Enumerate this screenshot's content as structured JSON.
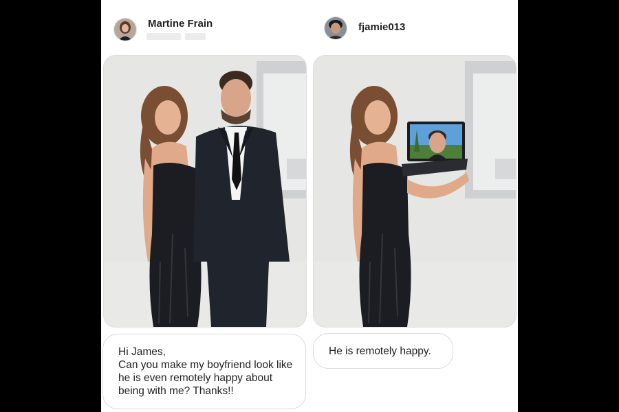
{
  "left_post": {
    "username": "Martine Frain",
    "timestamp": "",
    "comment_greeting": "Hi James,",
    "comment_text": "Can you make my boyfriend look like he is even remotely happy about being with me? Thanks!!"
  },
  "right_post": {
    "username": "fjamie013",
    "reply_text": "He is remotely happy."
  },
  "colors": {
    "panel_background": "#ffffff",
    "page_background": "#000000",
    "wall": "#e6e6e4",
    "dress": "#1b1d22",
    "suit": "#20242c",
    "bubble_border": "#dadada"
  }
}
